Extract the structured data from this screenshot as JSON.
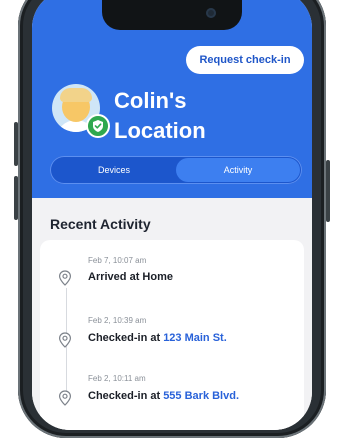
{
  "header": {
    "request_button_label": "Request check-in",
    "title_line1": "Colin's",
    "title_line2": "Location"
  },
  "tabs": [
    {
      "label": "Devices",
      "selected": false
    },
    {
      "label": "Activity",
      "selected": true
    }
  ],
  "activity": {
    "section_title": "Recent Activity",
    "items": [
      {
        "time": "Feb 7, 10:07 am",
        "text": "Arrived at Home",
        "link": ""
      },
      {
        "time": "Feb 2, 10:39 am",
        "text": "Checked-in at ",
        "link": "123 Main St."
      },
      {
        "time": "Feb 2, 10:11 am",
        "text": "Checked-in at ",
        "link": "555 Bark Blvd."
      }
    ]
  },
  "colors": {
    "brand_blue": "#2f6fe4",
    "tab_track": "#1c56cc",
    "tab_selected": "#3d7ff0",
    "link_blue": "#2962d9",
    "status_green": "#2fa84f"
  },
  "icons": [
    "location-pin-icon",
    "check-shield-icon",
    "avatar-icon"
  ]
}
